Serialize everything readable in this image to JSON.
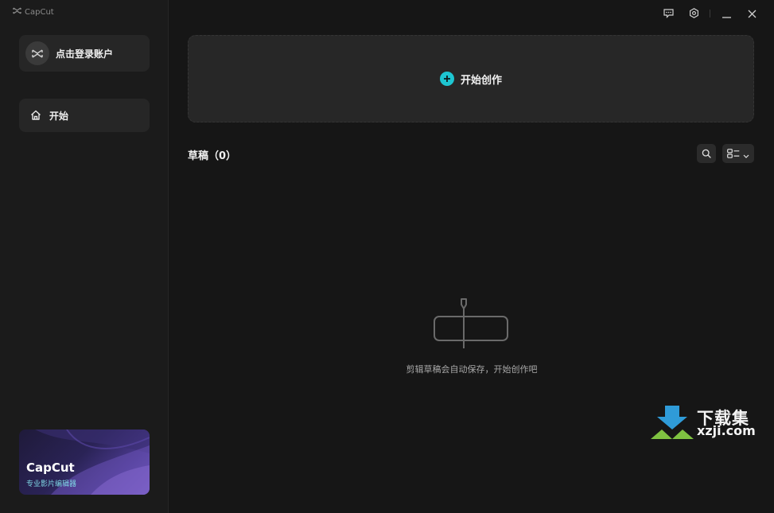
{
  "app": {
    "brand_name": "CapCut"
  },
  "sidebar": {
    "login_label": "点击登录账户",
    "nav": [
      {
        "label": "开始",
        "icon": "home-icon"
      }
    ],
    "promo": {
      "title": "CapCut",
      "subtitle": "专业影片编辑器"
    }
  },
  "titlebar": {
    "icons": [
      "feedback-icon",
      "settings-gear-icon",
      "minimize-icon",
      "close-icon"
    ]
  },
  "main": {
    "create_label": "开始创作",
    "drafts_title": "草稿（0）",
    "empty_text": "剪辑草稿会自动保存，开始创作吧",
    "tools": [
      "search-icon",
      "view-toggle-icon"
    ]
  },
  "watermark": {
    "title": "下载集",
    "url": "xzji.com"
  },
  "colors": {
    "accent": "#1ec6d2",
    "background": "#161616",
    "sidebar": "#1b1b1b",
    "card": "#272727"
  }
}
